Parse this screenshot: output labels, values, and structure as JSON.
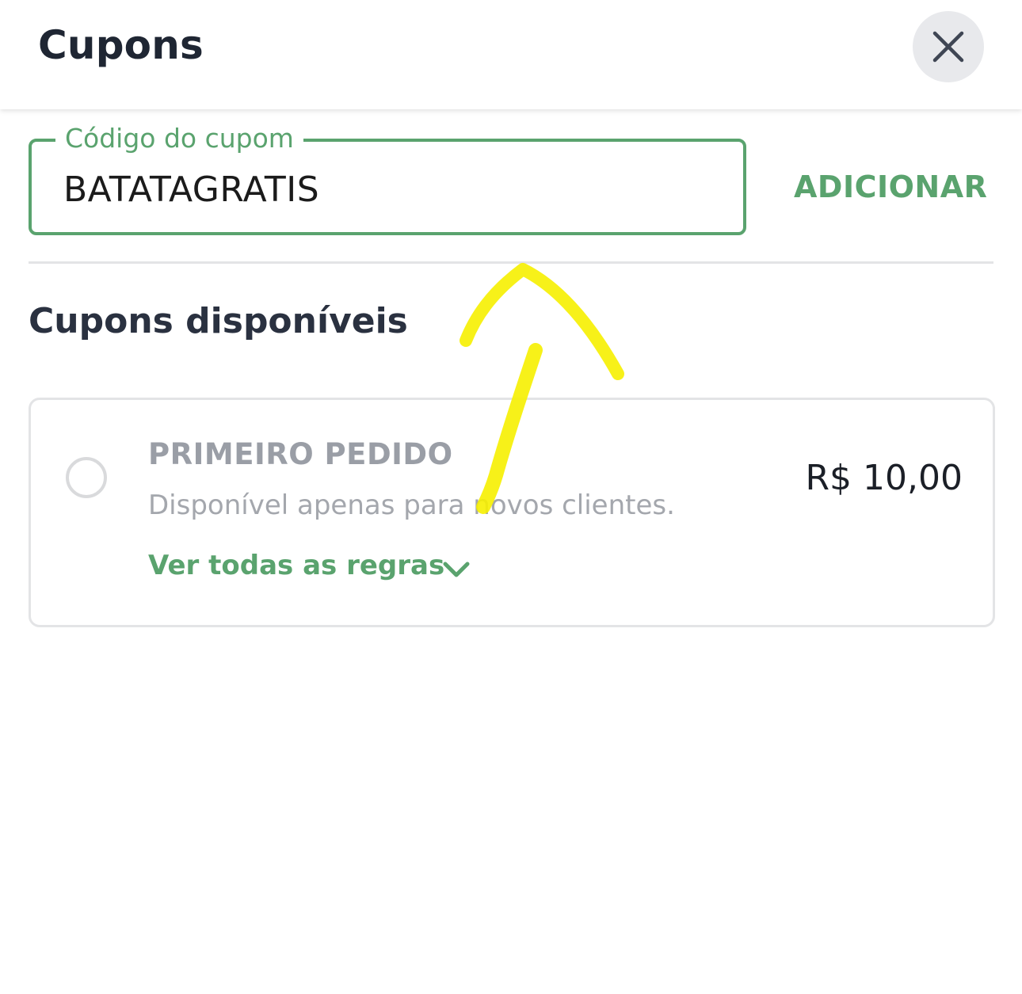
{
  "header": {
    "title": "Cupons",
    "close_icon": "close-icon"
  },
  "coupon_form": {
    "label": "Código do cupom",
    "value": "BATATAGRATIS",
    "add_label": "ADICIONAR"
  },
  "available": {
    "title": "Cupons disponíveis",
    "items": [
      {
        "name": "PRIMEIRO PEDIDO",
        "description": "Disponível apenas para novos clientes.",
        "value": "R$ 10,00",
        "rules_label": "Ver todas as regras",
        "selected": false
      }
    ]
  },
  "colors": {
    "accent": "#5aa36e",
    "title": "#1f2633",
    "muted": "#9a9ea6",
    "annotation": "#f6f000"
  }
}
